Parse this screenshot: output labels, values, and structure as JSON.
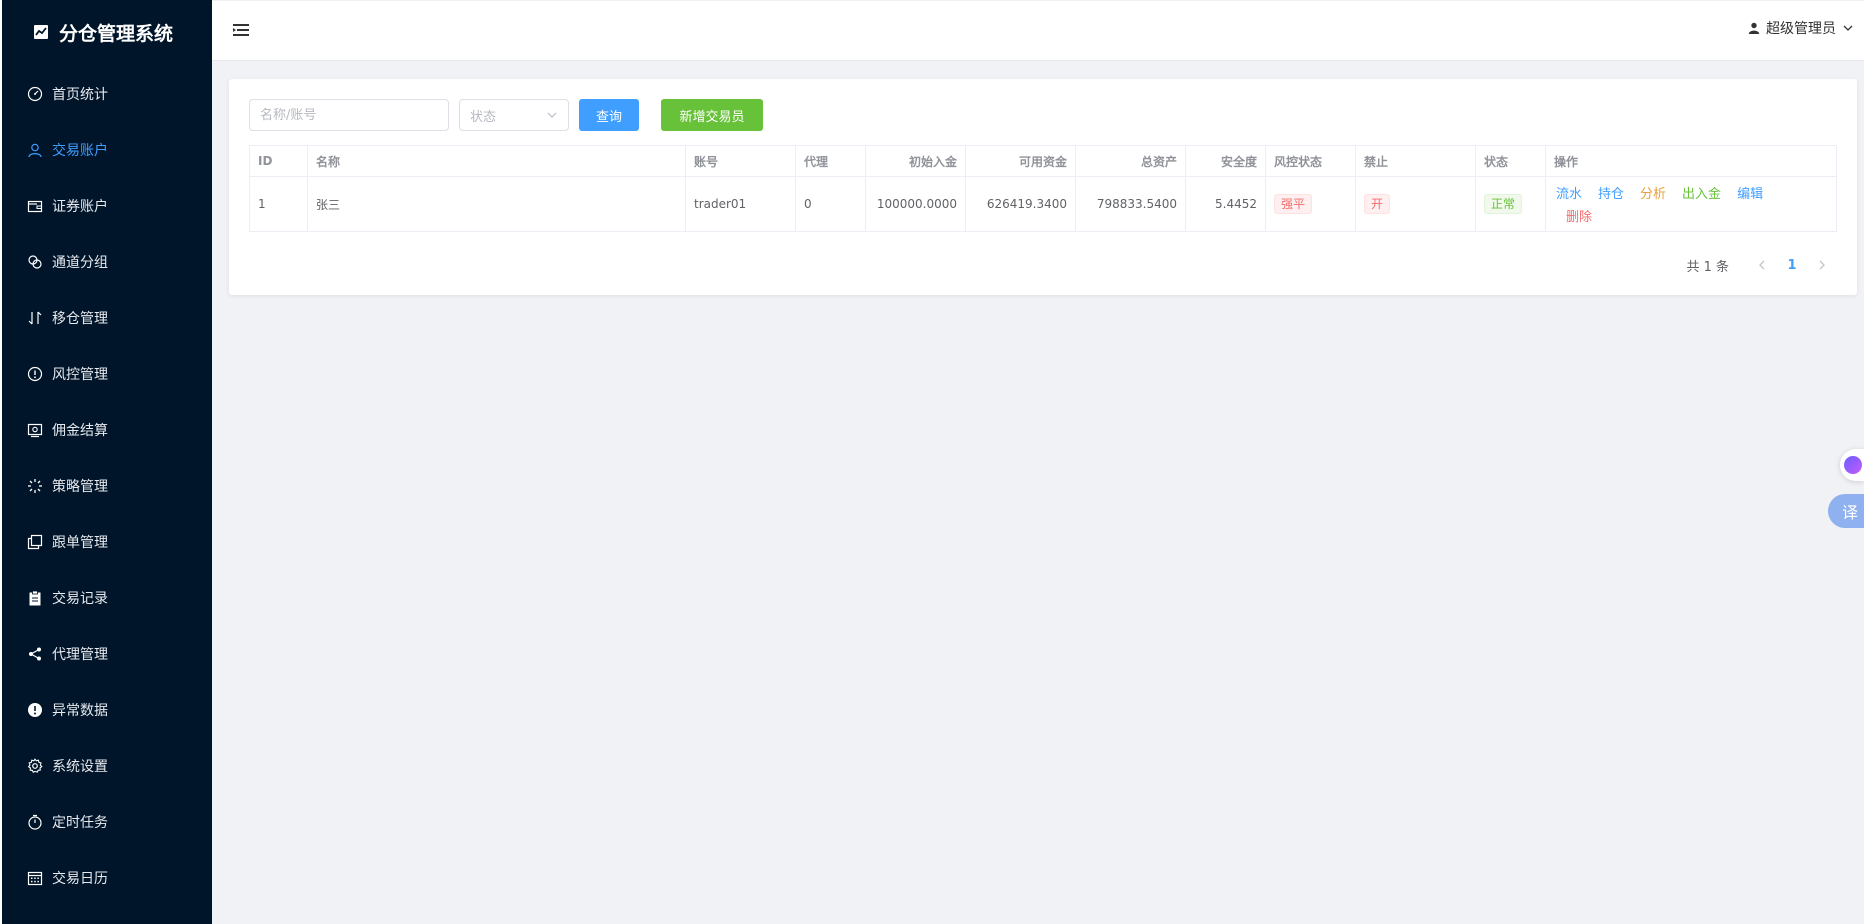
{
  "app": {
    "title": "分仓管理系统"
  },
  "sidebar": {
    "items": [
      {
        "label": "首页统计",
        "icon": "dashboard-icon"
      },
      {
        "label": "交易账户",
        "icon": "user-icon",
        "active": true
      },
      {
        "label": "证券账户",
        "icon": "wallet-icon"
      },
      {
        "label": "通道分组",
        "icon": "link-icon"
      },
      {
        "label": "移仓管理",
        "icon": "transfer-icon"
      },
      {
        "label": "风控管理",
        "icon": "warning-icon"
      },
      {
        "label": "佣金结算",
        "icon": "money-icon"
      },
      {
        "label": "策略管理",
        "icon": "loading-icon"
      },
      {
        "label": "跟单管理",
        "icon": "copy-icon"
      },
      {
        "label": "交易记录",
        "icon": "clipboard-icon"
      },
      {
        "label": "代理管理",
        "icon": "share-icon"
      },
      {
        "label": "异常数据",
        "icon": "alert-icon"
      },
      {
        "label": "系统设置",
        "icon": "gear-icon"
      },
      {
        "label": "定时任务",
        "icon": "timer-icon"
      },
      {
        "label": "交易日历",
        "icon": "calendar-icon"
      }
    ]
  },
  "header": {
    "user": "超级管理员"
  },
  "search": {
    "name_placeholder": "名称/账号",
    "status_placeholder": "状态",
    "query_label": "查询",
    "add_label": "新增交易员"
  },
  "table": {
    "headers": {
      "id": "ID",
      "name": "名称",
      "account": "账号",
      "agent": "代理",
      "initial": "初始入金",
      "available": "可用资金",
      "total": "总资产",
      "safety": "安全度",
      "risk": "风控状态",
      "ban": "禁止",
      "status": "状态",
      "ops": "操作"
    },
    "rows": [
      {
        "id": "1",
        "name": "张三",
        "account": "trader01",
        "agent": "0",
        "initial": "100000.0000",
        "available": "626419.3400",
        "total": "798833.5400",
        "safety": "5.4452",
        "risk": "强平",
        "ban": "开",
        "status": "正常"
      }
    ],
    "ops": {
      "flow": "流水",
      "position": "持仓",
      "analysis": "分析",
      "deposit": "出入金",
      "edit": "编辑",
      "delete": "删除"
    }
  },
  "pagination": {
    "total_text": "共 1 条",
    "current_page": "1"
  },
  "floating": {
    "translate": "译"
  },
  "colors": {
    "sidebar_bg": "#001529",
    "primary": "#409eff",
    "success": "#67c23a",
    "warning": "#e6a23c",
    "danger": "#f56c6c"
  }
}
